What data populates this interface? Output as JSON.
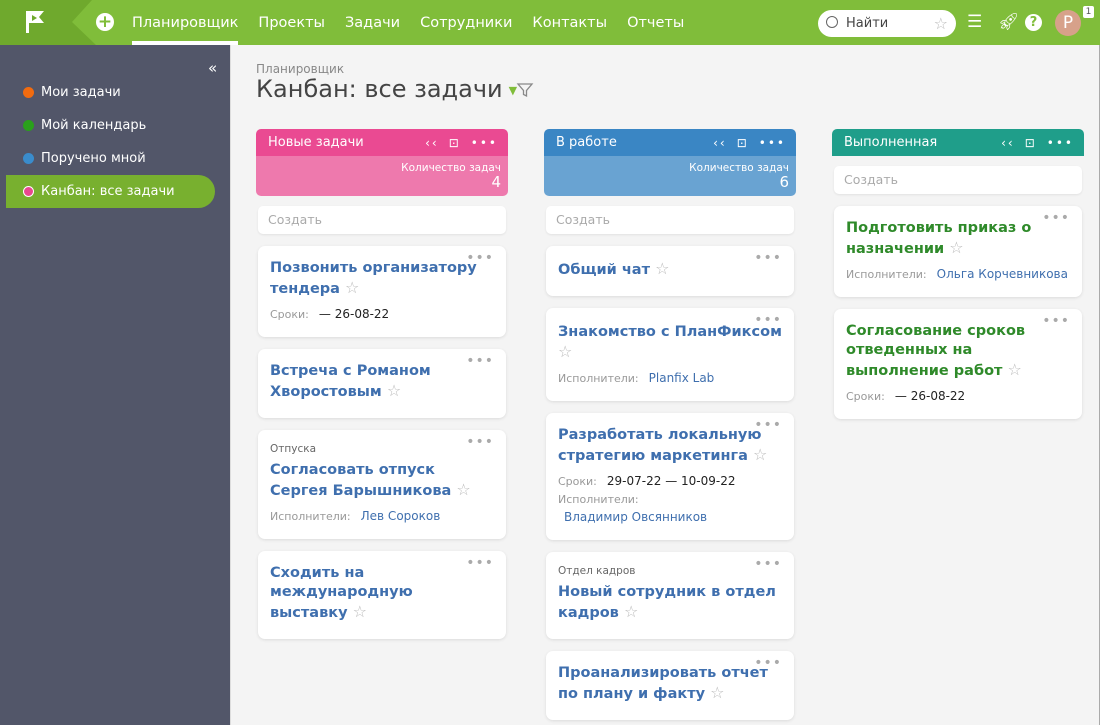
{
  "header": {
    "nav": [
      "Планировщик",
      "Проекты",
      "Задачи",
      "Сотрудники",
      "Контакты",
      "Отчеты"
    ],
    "search_placeholder": "Найти",
    "avatar": "P",
    "badge": "1"
  },
  "sidebar": {
    "items": [
      {
        "label": "Мои задачи",
        "color": "#f26b0f"
      },
      {
        "label": "Мой календарь",
        "color": "#2aa01b"
      },
      {
        "label": "Поручено мной",
        "color": "#3a8ccc"
      },
      {
        "label": "Канбан: все задачи",
        "color": "#e8488f"
      }
    ]
  },
  "page": {
    "breadcrumb": "Планировщик",
    "title": "Канбан: все задачи"
  },
  "columns": [
    {
      "title": "Новые задачи",
      "color": "#ea4a92",
      "sub_color": "#ee79ad",
      "count_label": "Количество задач",
      "count": "4",
      "create": "Создать",
      "cards": [
        {
          "title": "Позвонить организатору тендера",
          "rows": [
            {
              "label": "Сроки:",
              "value": "— 26-08-22"
            }
          ]
        },
        {
          "title": "Встреча с Романом Хворостовым"
        },
        {
          "tag": "Отпуска",
          "title": "Согласовать отпуск Сергея Барышникова",
          "rows": [
            {
              "label": "Исполнители:",
              "value": "Лев Сороков",
              "link": true
            }
          ]
        },
        {
          "title": "Сходить на международную выставку"
        }
      ]
    },
    {
      "title": "В работе",
      "color": "#3a86c4",
      "sub_color": "#69a3d2",
      "count_label": "Количество задач",
      "count": "6",
      "create": "Создать",
      "cards": [
        {
          "title": "Общий чат"
        },
        {
          "title": "Знакомство с ПланФиксом",
          "rows": [
            {
              "label": "Исполнители:",
              "value": "Planfix Lab",
              "link": true
            }
          ]
        },
        {
          "title": "Разработать локальную стратегию маркетинга",
          "rows": [
            {
              "label": "Сроки:",
              "value": "29-07-22 — 10-09-22"
            },
            {
              "label": "Исполнители:",
              "value": ""
            },
            {
              "label": "",
              "value": "Владимир Овсянников",
              "link": true
            }
          ]
        },
        {
          "tag": "Отдел кадров",
          "title": "Новый сотрудник в отдел кадров"
        },
        {
          "title": "Проанализировать отчет по плану и факту"
        }
      ]
    },
    {
      "title": "Выполненная",
      "color": "#1f9e8a",
      "create": "Создать",
      "green": true,
      "cards": [
        {
          "title": "Подготовить приказ о назначении",
          "rows": [
            {
              "label": "Исполнители:",
              "value": "Ольга Корчевникова",
              "link": true
            }
          ]
        },
        {
          "title": "Согласование сроков отведенных на выполнение работ",
          "rows": [
            {
              "label": "Сроки:",
              "value": "— 26-08-22"
            }
          ]
        }
      ]
    }
  ]
}
